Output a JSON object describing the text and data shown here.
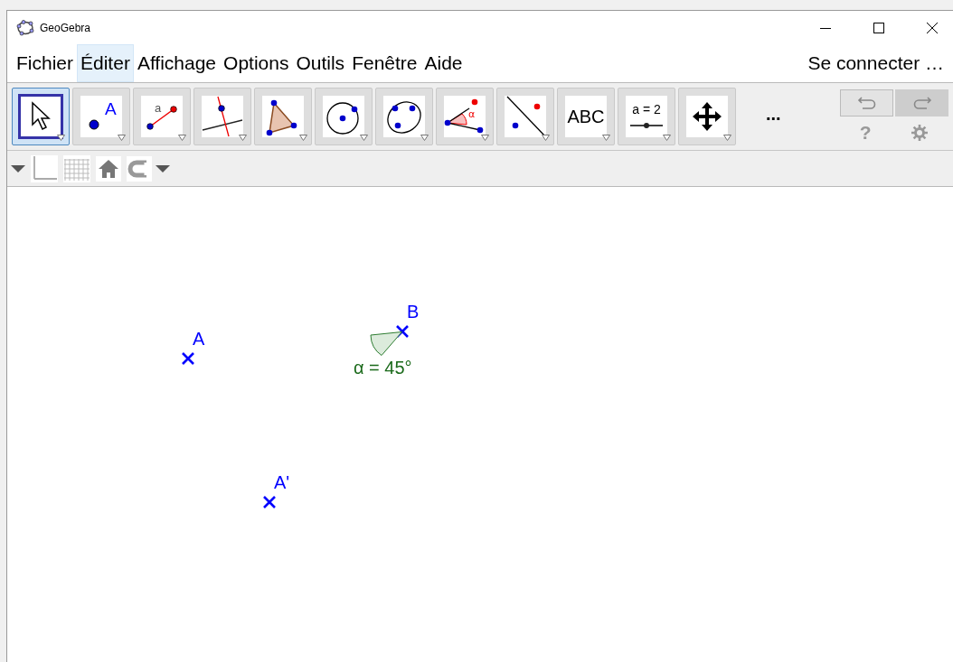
{
  "window": {
    "title": "GeoGebra"
  },
  "menu": [
    {
      "label": "Fichier",
      "selected": false
    },
    {
      "label": "Éditer",
      "selected": true
    },
    {
      "label": "Affichage",
      "selected": false
    },
    {
      "label": "Options",
      "selected": false
    },
    {
      "label": "Outils",
      "selected": false
    },
    {
      "label": "Fenêtre",
      "selected": false
    },
    {
      "label": "Aide",
      "selected": false
    }
  ],
  "sign_in": "Se connecter …",
  "tools": [
    {
      "kind": "move",
      "selected": true
    },
    {
      "kind": "point",
      "label": "A",
      "selected": false
    },
    {
      "kind": "segment",
      "label": "a",
      "selected": false
    },
    {
      "kind": "perpendicular",
      "selected": false
    },
    {
      "kind": "polygon",
      "selected": false
    },
    {
      "kind": "circle",
      "selected": false
    },
    {
      "kind": "conic",
      "selected": false
    },
    {
      "kind": "angle",
      "label": "α",
      "selected": false
    },
    {
      "kind": "reflect",
      "selected": false
    },
    {
      "kind": "text",
      "label": "ABC",
      "selected": false
    },
    {
      "kind": "slider",
      "label": "a = 2",
      "selected": false
    },
    {
      "kind": "pan",
      "selected": false
    }
  ],
  "more_tools": "...",
  "undo": {
    "enabled": true
  },
  "redo": {
    "enabled": false
  },
  "help": "?",
  "style_bar": {
    "axes_shown": false,
    "grid_shown": false
  },
  "objects": [
    {
      "kind": "point",
      "name": "A"
    },
    {
      "kind": "point",
      "name": "B"
    },
    {
      "kind": "angle",
      "label": "α = 45°"
    },
    {
      "kind": "point",
      "name": "A'"
    }
  ]
}
